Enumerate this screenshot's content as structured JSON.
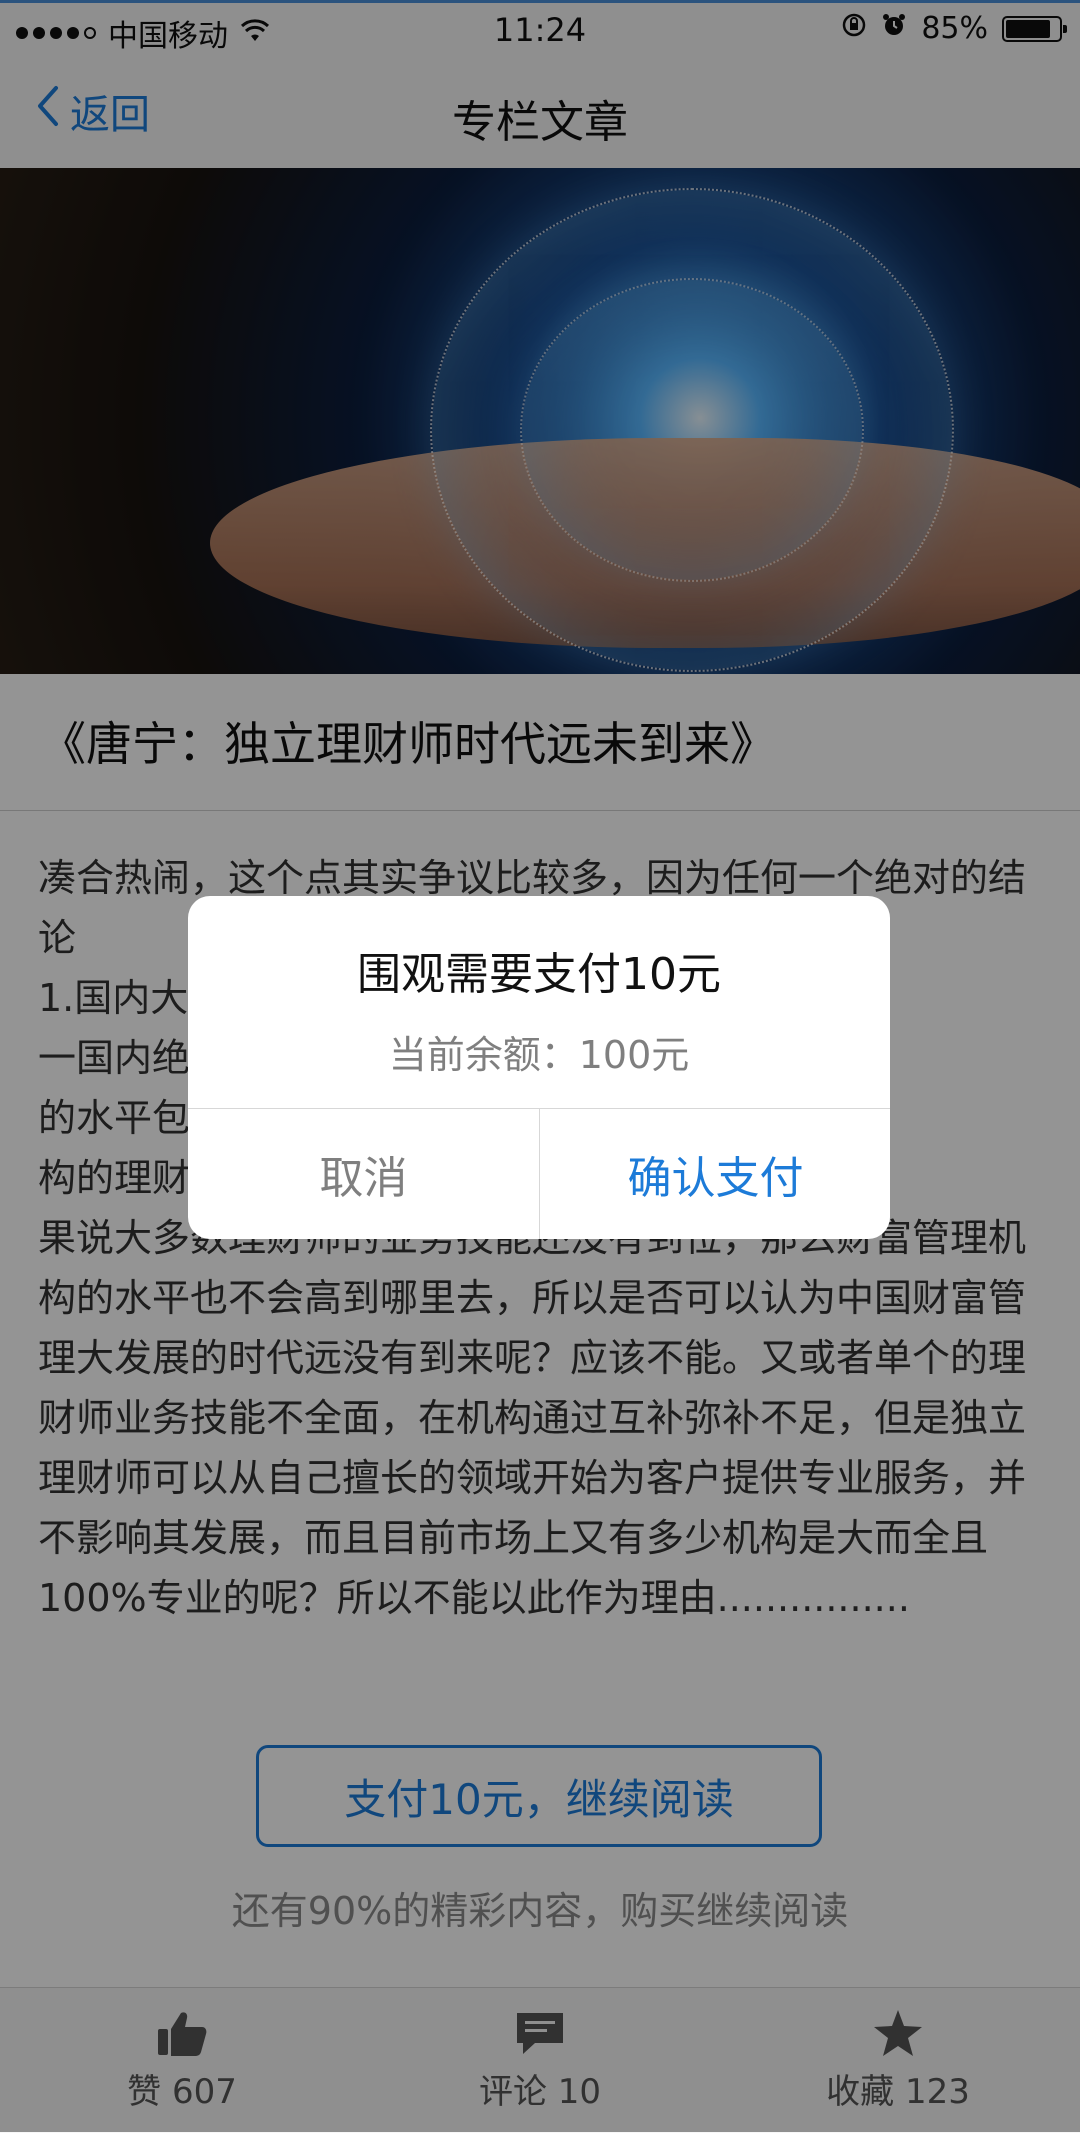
{
  "status_bar": {
    "carrier": "中国移动",
    "time": "11:24",
    "battery": "85%",
    "battery_level": 0.85
  },
  "nav": {
    "back_label": "返回",
    "title": "专栏文章"
  },
  "article": {
    "title": "《唐宁：独立理财师时代远未到来》",
    "paragraphs": [
      "凑合热闹，这个点其实争议比较多，因为任何一个绝对的结论",
      "1.国内大",
      "一国内绝大多数理",
      "的水平包含多方面",
      "构的理财师的水平",
      "果说大多数理财师的业务技能还没有到位，那么财富管理机构的水平也不会高到哪里去，所以是否可以认为中国财富管理大发展的时代远没有到来呢？应该不能。又或者单个的理财师业务技能不全面，在机构通过互补弥补不足，但是独立理财师可以从自己擅长的领域开始为客户提供专业服务，并不影响其发展，而且目前市场上又有多少机构是大而全且100%专业的呢？所以不能以此作为理由................"
    ]
  },
  "paywall": {
    "pay_button_label": "支付10元，继续阅读",
    "remaining_text": "还有90%的精彩内容，购买继续阅读"
  },
  "tabbar": {
    "like": "赞 607",
    "comment": "评论 10",
    "favorite": "收藏 123"
  },
  "dialog": {
    "title": "围观需要支付10元",
    "balance": "当前余额：100元",
    "cancel_label": "取消",
    "confirm_label": "确认支付"
  },
  "colors": {
    "accent": "#1d7bd8",
    "overlay": "rgba(0,0,0,0.42)"
  }
}
